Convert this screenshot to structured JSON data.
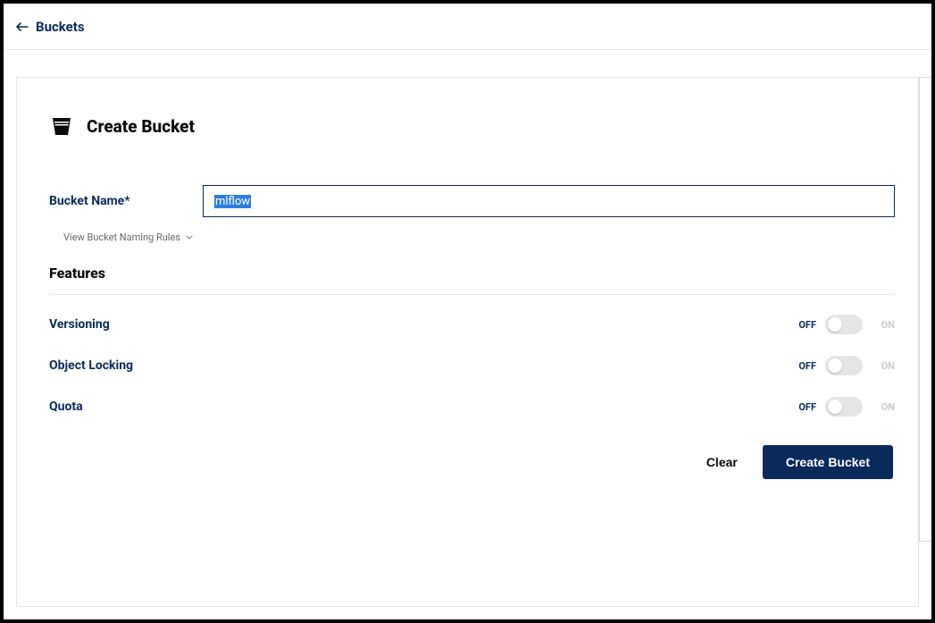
{
  "breadcrumb": {
    "label": "Buckets"
  },
  "page": {
    "title": "Create Bucket"
  },
  "form": {
    "bucketName": {
      "label": "Bucket Name*",
      "value": "mlflow"
    },
    "namingRulesLink": "View Bucket Naming Rules"
  },
  "features": {
    "sectionTitle": "Features",
    "items": [
      {
        "label": "Versioning",
        "state": "OFF",
        "altState": "ON"
      },
      {
        "label": "Object Locking",
        "state": "OFF",
        "altState": "ON"
      },
      {
        "label": "Quota",
        "state": "OFF",
        "altState": "ON"
      }
    ]
  },
  "actions": {
    "clear": "Clear",
    "create": "Create Bucket"
  }
}
